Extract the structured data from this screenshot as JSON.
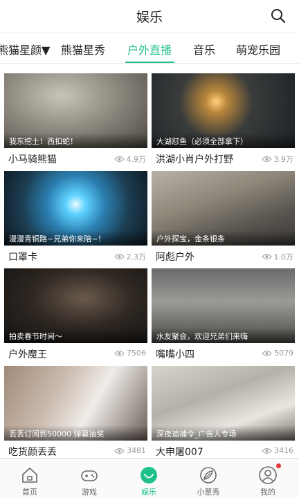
{
  "header": {
    "title": "娱乐",
    "search_icon": "search-icon"
  },
  "tabs": [
    {
      "label": "熊猫星颜▼",
      "active": false
    },
    {
      "label": "熊猫星秀",
      "active": false
    },
    {
      "label": "户外直播",
      "active": true
    },
    {
      "label": "音乐",
      "active": false
    },
    {
      "label": "萌宠乐园",
      "active": false
    }
  ],
  "cards": [
    {
      "caption": "我东挖土！西扣蛇！",
      "name": "小马骑熊猫",
      "views": "4.9万"
    },
    {
      "caption": "大湖怼鱼（必须全部拿下）",
      "name": "洪湖小肖户外打野",
      "views": "3.9万"
    },
    {
      "caption": "漫漫青铜路~兄弟你来陪~！",
      "name": "口罩卡",
      "views": "2.3万"
    },
    {
      "caption": "户外探宝，金条银条",
      "name": "阿彪户外",
      "views": "1.0万"
    },
    {
      "caption": "拍卖春节时间～",
      "name": "户外魔王",
      "views": "7506"
    },
    {
      "caption": "水友聚会，欢迎兄弟们来嗨",
      "name": "嘴嘴小四",
      "views": "5079"
    },
    {
      "caption": "丢丢订阅到50000 弹幕抽奖",
      "name": "吃货颜丢丢",
      "views": "3481"
    },
    {
      "caption": "深夜追捕令_广告人专场",
      "name": "大申屠007",
      "views": "3416"
    }
  ],
  "bottom_nav": [
    {
      "label": "首页",
      "icon": "home-icon",
      "active": false
    },
    {
      "label": "游戏",
      "icon": "gamepad-icon",
      "active": false
    },
    {
      "label": "娱乐",
      "icon": "entertainment-icon",
      "active": true
    },
    {
      "label": "小葱秀",
      "icon": "leaf-icon",
      "active": false
    },
    {
      "label": "我的",
      "icon": "user-icon",
      "active": false,
      "badge": true
    }
  ],
  "colors": {
    "accent": "#1ec18b",
    "badge": "#e63b3b"
  }
}
